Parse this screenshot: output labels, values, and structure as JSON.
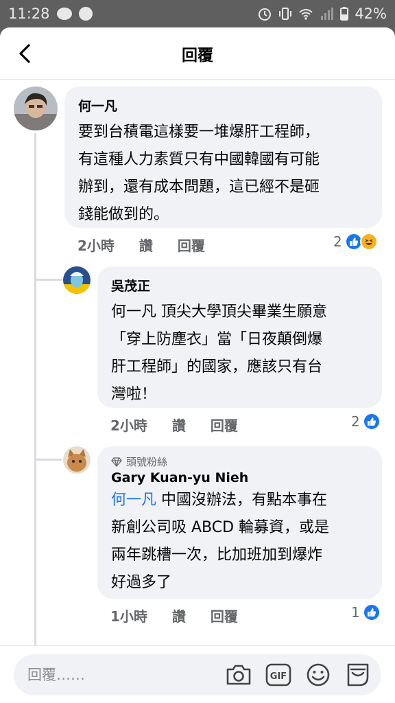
{
  "status_bar": {
    "time": "11:28",
    "battery": "42%"
  },
  "header": {
    "title": "回覆"
  },
  "comments": [
    {
      "author": "何一凡",
      "text": "要到台積電這樣要一堆爆肝工程師，\n有這種人力素質只有中國韓國有可能\n辦到，還有成本問題，這已經不是砸\n錢能做到的。",
      "time": "2小時",
      "like_label": "讚",
      "reply_label": "回覆",
      "reaction_count": "2"
    },
    {
      "author": "吳茂正",
      "text": "何一凡 頂尖大學頂尖畢業生願意\n「穿上防塵衣」當「日夜顛倒爆\n肝工程師」的國家，應該只有台\n灣啦！",
      "time": "2小時",
      "like_label": "讚",
      "reply_label": "回覆",
      "reaction_count": "2"
    },
    {
      "badge": "頭號粉絲",
      "author": "Gary Kuan-yu Nieh",
      "mention": "何一凡",
      "text": " 中國沒辦法，有點本事在\n新創公司吸 ABCD 輪募資，或是\n兩年跳槽一次，比加班加到爆炸\n好過多了",
      "time": "1小時",
      "like_label": "讚",
      "reply_label": "回覆",
      "reaction_count": "1"
    }
  ],
  "composer": {
    "placeholder": "回覆……",
    "gif_label": "GIF"
  },
  "colors": {
    "accent": "#1877f2",
    "bubble": "#f0f2f5",
    "meta": "#65676b"
  }
}
